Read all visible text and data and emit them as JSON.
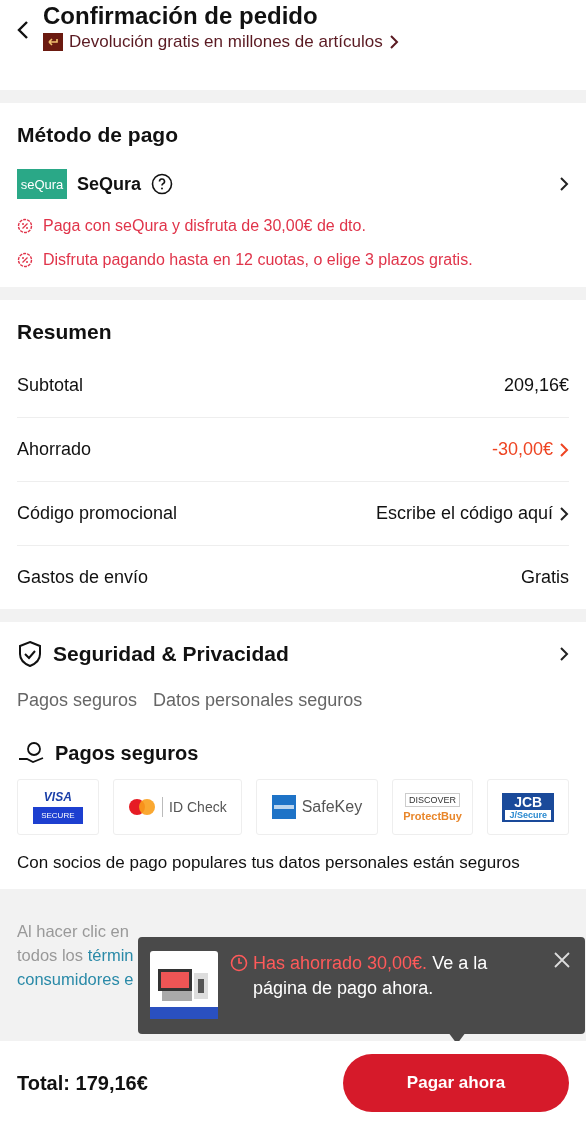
{
  "header": {
    "title": "Confirmación de pedido",
    "banner": "Devolución gratis en millones de artículos"
  },
  "payment": {
    "title": "Método de pago",
    "method": "SeQura",
    "logo_text": "seQura",
    "promos": [
      "Paga con seQura y disfruta de 30,00€ de dto.",
      "Disfruta pagando hasta en 12 cuotas, o elige 3 plazos gratis."
    ]
  },
  "summary": {
    "title": "Resumen",
    "rows": [
      {
        "label": "Subtotal",
        "value": "209,16€",
        "kind": "plain"
      },
      {
        "label": "Ahorrado",
        "value": "-30,00€",
        "kind": "discount"
      },
      {
        "label": "Código promocional",
        "value": "Escribe el código aquí",
        "kind": "link"
      },
      {
        "label": "Gastos de envío",
        "value": "Gratis",
        "kind": "plain"
      }
    ]
  },
  "security": {
    "title": "Seguridad & Privacidad",
    "tabs": [
      "Pagos seguros",
      "Datos personales seguros"
    ],
    "subtitle": "Pagos seguros",
    "partners": [
      {
        "kind": "visa",
        "text": "VISA",
        "sub": "SECURE"
      },
      {
        "kind": "mastercard",
        "text": "ID Check"
      },
      {
        "kind": "amex",
        "text": "SafeKey"
      },
      {
        "kind": "discover",
        "text": "ProtectBuy",
        "sub": "DISCOVER"
      },
      {
        "kind": "jcb",
        "text": "JCB",
        "sub": "J/Secure"
      }
    ],
    "note": "Con socios de pago populares tus datos personales están seguros"
  },
  "legal": {
    "lines": [
      {
        "text": "Al hacer clic en"
      },
      {
        "text": "todos los ",
        "link": "términ"
      },
      {
        "link": "consumidores e"
      }
    ]
  },
  "toast": {
    "highlight": "Has ahorrado 30,00€.",
    "text": "Ve a la página de pago ahora."
  },
  "footer": {
    "total": "Total: 179,16€",
    "button": "Pagar ahora"
  }
}
